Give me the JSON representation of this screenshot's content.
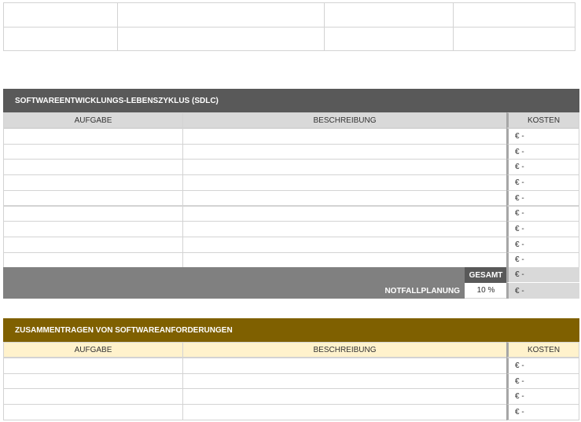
{
  "top_grid": {
    "rows": 2,
    "cols": 4
  },
  "sdlc": {
    "title": "SOFTWAREENTWICKLUNGS-LEBENSZYKLUS (SDLC)",
    "col_task": "AUFGABE",
    "col_desc": "BESCHREIBUNG",
    "col_cost": "KOSTEN",
    "rows": [
      {
        "task": "",
        "desc": "",
        "cost": "€ -"
      },
      {
        "task": "",
        "desc": "",
        "cost": "€ -"
      },
      {
        "task": "",
        "desc": "",
        "cost": "€ -"
      },
      {
        "task": "",
        "desc": "",
        "cost": "€ -"
      },
      {
        "task": "",
        "desc": "",
        "cost": "€ -"
      },
      {
        "task": "",
        "desc": "",
        "cost": "€ -"
      },
      {
        "task": "",
        "desc": "",
        "cost": "€ -"
      },
      {
        "task": "",
        "desc": "",
        "cost": "€ -"
      },
      {
        "task": "",
        "desc": "",
        "cost": "€ -"
      }
    ],
    "total_label": "GESAMT",
    "total_value": "€ -",
    "contingency_label": "NOTFALLPLANUNG",
    "contingency_percent": "10 %",
    "contingency_value": "€ -"
  },
  "requirements": {
    "title": "ZUSAMMENTRAGEN VON SOFTWAREANFORDERUNGEN",
    "col_task": "AUFGABE",
    "col_desc": "BESCHREIBUNG",
    "col_cost": "KOSTEN",
    "rows": [
      {
        "task": "",
        "desc": "",
        "cost": "€ -"
      },
      {
        "task": "",
        "desc": "",
        "cost": "€ -"
      },
      {
        "task": "",
        "desc": "",
        "cost": "€ -"
      },
      {
        "task": "",
        "desc": "",
        "cost": "€ -"
      }
    ]
  },
  "colors": {
    "sdlc_title_bg": "#595959",
    "sdlc_header_bg": "#d9d9d9",
    "sdlc_total_bar": "#808080",
    "sdlc_total_label_bg": "#595959",
    "sdlc_cost_total_bg": "#d9d9d9",
    "req_title_bg": "#7f6000",
    "req_header_bg": "#fff2cc"
  }
}
